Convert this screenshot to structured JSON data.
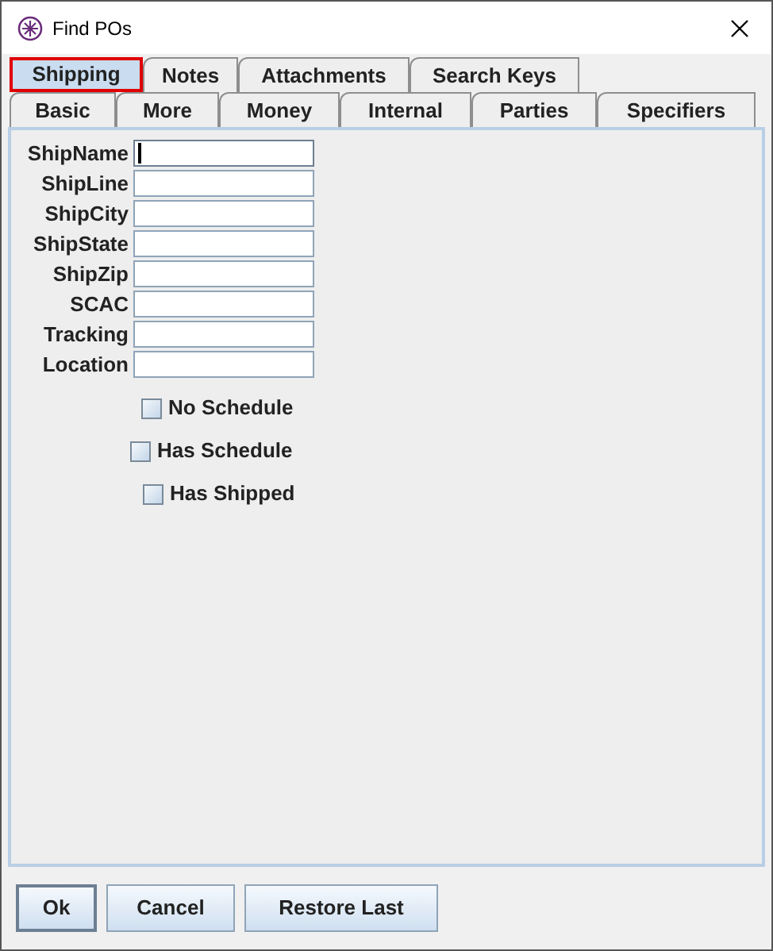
{
  "window": {
    "title": "Find POs"
  },
  "tab_rows": [
    [
      {
        "label": "Shipping",
        "selected": true
      },
      {
        "label": "Notes",
        "selected": false
      },
      {
        "label": "Attachments",
        "selected": false
      },
      {
        "label": "Search Keys",
        "selected": false
      }
    ],
    [
      {
        "label": "Basic",
        "selected": false
      },
      {
        "label": "More",
        "selected": false
      },
      {
        "label": "Money",
        "selected": false
      },
      {
        "label": "Internal",
        "selected": false
      },
      {
        "label": "Parties",
        "selected": false
      },
      {
        "label": "Specifiers",
        "selected": false
      }
    ]
  ],
  "fields": [
    {
      "label": "ShipName",
      "focused": true
    },
    {
      "label": "ShipLine",
      "focused": false
    },
    {
      "label": "ShipCity",
      "focused": false
    },
    {
      "label": "ShipState",
      "focused": false
    },
    {
      "label": "ShipZip",
      "focused": false
    },
    {
      "label": "SCAC",
      "focused": false
    },
    {
      "label": "Tracking",
      "focused": false
    },
    {
      "label": "Location",
      "focused": false
    }
  ],
  "checkboxes": [
    {
      "label": "No Schedule",
      "checked": false
    },
    {
      "label": "Has Schedule",
      "checked": false
    },
    {
      "label": "Has Shipped",
      "checked": false
    }
  ],
  "buttons": [
    {
      "label": "Ok",
      "default": true
    },
    {
      "label": "Cancel",
      "default": false
    },
    {
      "label": "Restore Last",
      "default": false
    }
  ]
}
